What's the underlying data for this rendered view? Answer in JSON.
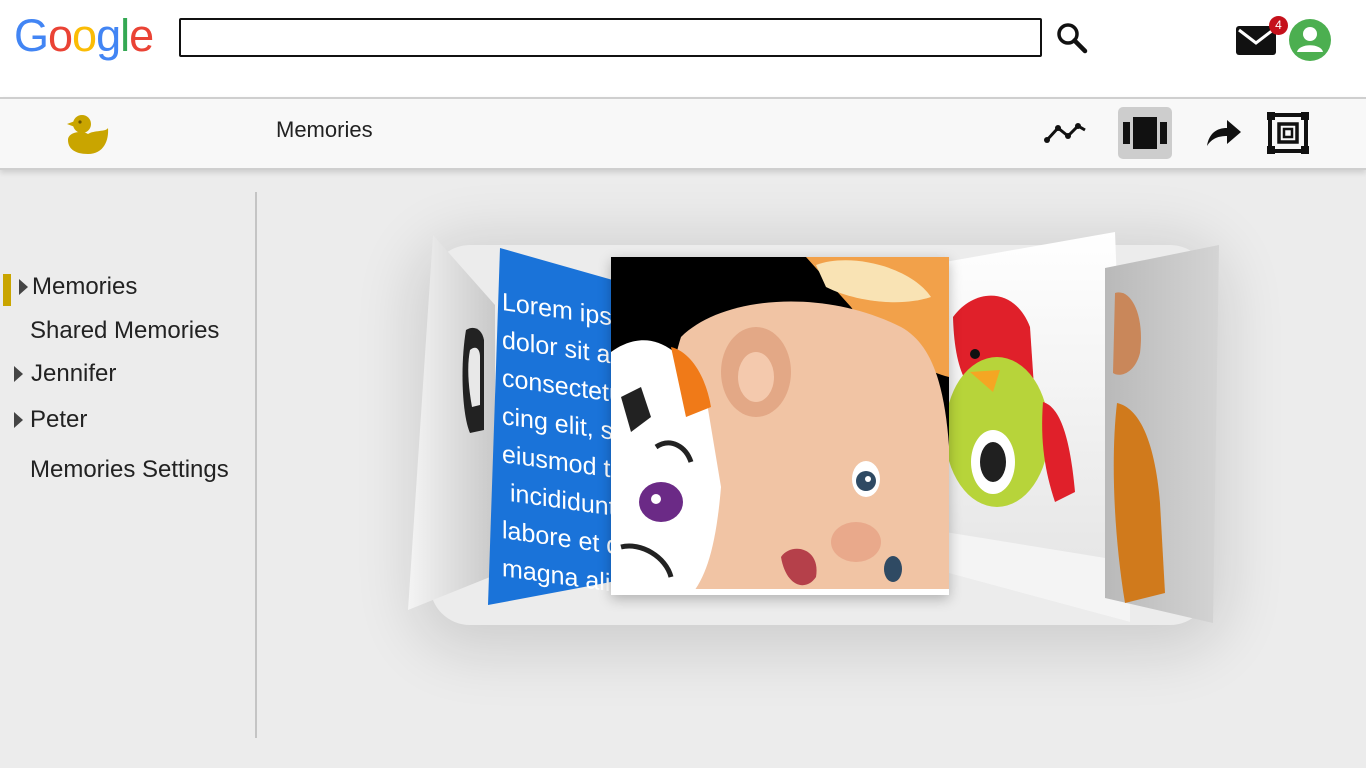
{
  "google": {
    "logo_letters": [
      "G",
      "o",
      "o",
      "g",
      "l",
      "e"
    ],
    "logo_colors": [
      "#4285F4",
      "#EA4335",
      "#FBBC05",
      "#4285F4",
      "#34A853",
      "#EA4335"
    ],
    "search_value": "",
    "search_icon": "search-icon",
    "mail_icon": "mail-icon",
    "mail_badge_count": "4",
    "avatar_icon": "account-icon",
    "avatar_color": "#4caf50"
  },
  "appbar": {
    "logo_icon": "duck-icon",
    "logo_color": "#c9a500",
    "title": "Memories",
    "tools": [
      {
        "name": "timeline-view-button",
        "icon": "line-chart-icon",
        "active": false
      },
      {
        "name": "carousel-view-button",
        "icon": "carousel-icon",
        "active": true
      },
      {
        "name": "share-button",
        "icon": "share-arrow-icon",
        "active": false
      },
      {
        "name": "fullscreen-button",
        "icon": "fullscreen-frame-icon",
        "active": false
      }
    ]
  },
  "sidebar": {
    "items": [
      {
        "label": "Memories",
        "selected": true,
        "expandable": true
      },
      {
        "label": "Shared Memories",
        "selected": false,
        "expandable": false
      },
      {
        "label": "Jennifer",
        "selected": false,
        "expandable": true
      },
      {
        "label": "Peter",
        "selected": false,
        "expandable": true
      },
      {
        "label": "Memories Settings",
        "selected": false,
        "expandable": false
      }
    ],
    "accent_color": "#c9a500"
  },
  "carousel": {
    "text_card_lines": [
      "Lorem ipsum",
      "dolor sit am",
      "consectetur",
      "cing elit, se",
      "eiusmod te",
      "incididunt",
      "labore et d",
      "magna ali"
    ],
    "text_card_color": "#1a73d9"
  }
}
